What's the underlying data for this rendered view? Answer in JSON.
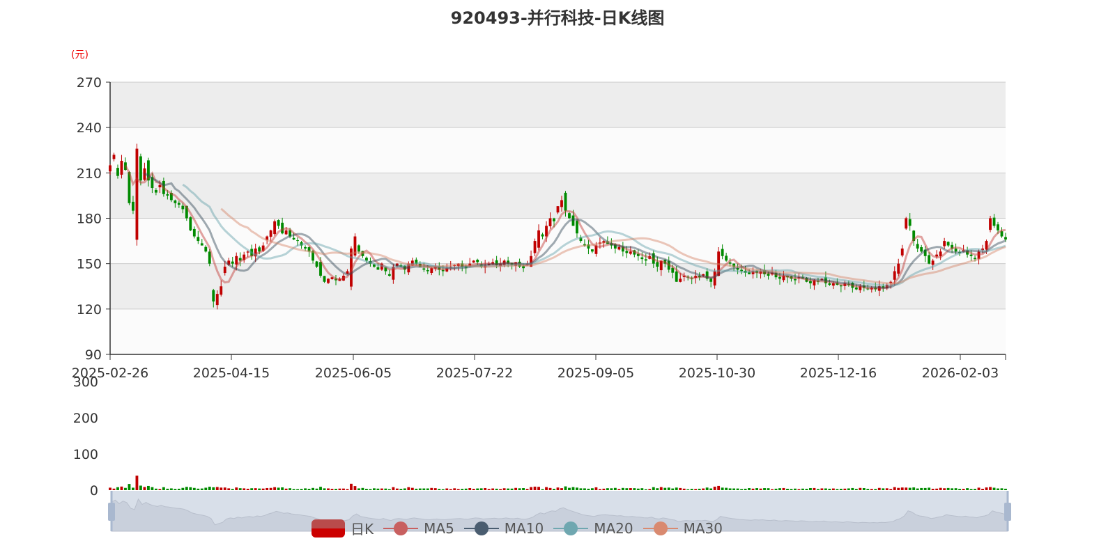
{
  "chart_data": {
    "type": "candlestick",
    "title": "920493-并行科技-日K线图",
    "ylabel": "(元)",
    "ylim": [
      90,
      270
    ],
    "yticks": [
      "270",
      "240",
      "210",
      "180",
      "150",
      "120",
      "90"
    ],
    "xticks": [
      "2025-02-26",
      "2025-04-15",
      "2025-06-05",
      "2025-07-22",
      "2025-09-05",
      "2025-10-30",
      "2025-12-16",
      "2026-02-03"
    ],
    "volume_ylim": [
      0,
      300
    ],
    "volume_yticks": [
      "300",
      "200",
      "100",
      "0"
    ],
    "legend": [
      "日K",
      "MA5",
      "MA10",
      "MA20",
      "MA30"
    ],
    "colors": {
      "up": "#c00000",
      "down": "#008a00",
      "MA5": "#c23531",
      "MA10": "#2f4554",
      "MA20": "#61a0a8",
      "MA30": "#d48265"
    },
    "closes": [
      215,
      222,
      208,
      218,
      212,
      190,
      185,
      226,
      205,
      213,
      205,
      200,
      197,
      202,
      196,
      195,
      192,
      190,
      189,
      186,
      180,
      172,
      168,
      165,
      162,
      158,
      150,
      125,
      130,
      135,
      148,
      152,
      150,
      155,
      152,
      156,
      158,
      155,
      160,
      158,
      162,
      168,
      172,
      178,
      175,
      170,
      172,
      168,
      166,
      165,
      162,
      160,
      158,
      152,
      148,
      142,
      138,
      140,
      141,
      139,
      140,
      142,
      145,
      160,
      168,
      158,
      155,
      152,
      150,
      148,
      146,
      150,
      145,
      142,
      148,
      150,
      148,
      146,
      150,
      152,
      150,
      148,
      146,
      145,
      147,
      148,
      146,
      145,
      147,
      148,
      149,
      150,
      148,
      147,
      150,
      152,
      151,
      148,
      149,
      150,
      151,
      149,
      150,
      152,
      150,
      149,
      151,
      148,
      147,
      150,
      155,
      165,
      172,
      168,
      175,
      180,
      178,
      188,
      192,
      185,
      180,
      175,
      170,
      165,
      162,
      160,
      158,
      162,
      164,
      165,
      163,
      162,
      160,
      161,
      158,
      157,
      158,
      156,
      155,
      153,
      152,
      155,
      150,
      148,
      152,
      150,
      146,
      144,
      138,
      140,
      142,
      141,
      140,
      142,
      141,
      143,
      140,
      138,
      145,
      158,
      155,
      152,
      150,
      148,
      146,
      145,
      144,
      143,
      145,
      144,
      145,
      143,
      142,
      144,
      141,
      140,
      142,
      141,
      140,
      139,
      141,
      140,
      138,
      137,
      139,
      138,
      140,
      137,
      136,
      137,
      136,
      135,
      137,
      136,
      134,
      133,
      135,
      134,
      133,
      134,
      133,
      135,
      134,
      136,
      138,
      145,
      150,
      160,
      180,
      175,
      165,
      160,
      158,
      155,
      150,
      152,
      156,
      158,
      165,
      162,
      160,
      158,
      157,
      159,
      156,
      155,
      153,
      158,
      160,
      165,
      180,
      175,
      172,
      168,
      166
    ]
  }
}
